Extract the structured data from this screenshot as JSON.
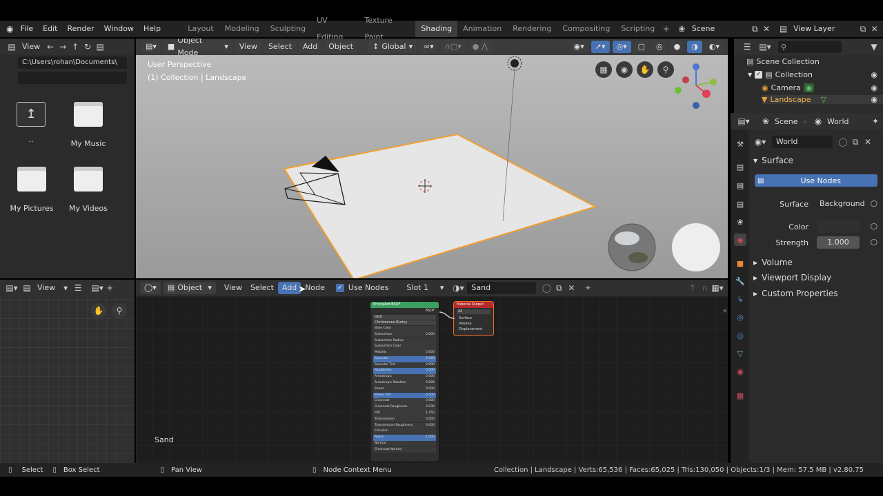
{
  "menu": {
    "file": "File",
    "edit": "Edit",
    "render": "Render",
    "window": "Window",
    "help": "Help"
  },
  "workspaces": [
    {
      "label": "Layout",
      "active": false
    },
    {
      "label": "Modeling",
      "active": false
    },
    {
      "label": "Sculpting",
      "active": false
    },
    {
      "label": "UV Editing",
      "active": false
    },
    {
      "label": "Texture Paint",
      "active": false
    },
    {
      "label": "Shading",
      "active": true
    },
    {
      "label": "Animation",
      "active": false
    },
    {
      "label": "Rendering",
      "active": false
    },
    {
      "label": "Compositing",
      "active": false
    },
    {
      "label": "Scripting",
      "active": false
    }
  ],
  "scene_name": "Scene",
  "view_layer_name": "View Layer",
  "file_browser": {
    "view_label": "View",
    "path": "C:\\Users\\rohan\\Documents\\",
    "parent_label": "..",
    "folders": [
      "My Music",
      "My Pictures",
      "My Videos"
    ]
  },
  "viewport": {
    "mode": "Object Mode",
    "view": "View",
    "select": "Select",
    "add": "Add",
    "object": "Object",
    "orientation": "Global",
    "perspective_label": "User Perspective",
    "collection_label": "(1) Collection | Landscape"
  },
  "outliner": {
    "scene_collection": "Scene Collection",
    "collection": "Collection",
    "camera": "Camera",
    "landscape": "Landscape"
  },
  "properties": {
    "scene_tab": "Scene",
    "world_tab": "World",
    "world_name": "World",
    "surface_panel": "Surface",
    "use_nodes_button": "Use Nodes",
    "surface_label": "Surface",
    "surface_value": "Background",
    "color_label": "Color",
    "strength_label": "Strength",
    "strength_value": "1.000",
    "volume_panel": "Volume",
    "viewport_display_panel": "Viewport Display",
    "custom_properties_panel": "Custom Properties",
    "colors": {
      "use_nodes_bg": "#4772b3",
      "accent": "#e8a040"
    }
  },
  "image_editor": {
    "view": "View"
  },
  "node_editor": {
    "object_label": "Object",
    "view": "View",
    "select": "Select",
    "add": "Add",
    "node": "Node",
    "use_nodes": "Use Nodes",
    "slot": "Slot 1",
    "material": "Sand",
    "material_label": "Sand",
    "principled_title": "Principled BSDF",
    "principled_output": "BSDF",
    "dist": "GGX",
    "subsurface_method": "Christensen-Burley",
    "output_title": "Material Output",
    "output_target": "All",
    "output_sockets": [
      "Surface",
      "Volume",
      "Displacement"
    ],
    "principled_inputs": [
      {
        "label": "Base Color",
        "value": ""
      },
      {
        "label": "Subsurface",
        "value": "0.000"
      },
      {
        "label": "Subsurface Radius",
        "value": ""
      },
      {
        "label": "Subsurface Color",
        "value": ""
      },
      {
        "label": "Metallic",
        "value": "0.000"
      },
      {
        "label": "Specular",
        "value": "0.500"
      },
      {
        "label": "Specular Tint",
        "value": "0.000"
      },
      {
        "label": "Roughness",
        "value": "0.500"
      },
      {
        "label": "Anisotropic",
        "value": "0.000"
      },
      {
        "label": "Anisotropic Rotation",
        "value": "0.000"
      },
      {
        "label": "Sheen",
        "value": "0.000"
      },
      {
        "label": "Sheen Tint",
        "value": "0.500"
      },
      {
        "label": "Clearcoat",
        "value": "0.000"
      },
      {
        "label": "Clearcoat Roughness",
        "value": "0.030"
      },
      {
        "label": "IOR",
        "value": "1.450"
      },
      {
        "label": "Transmission",
        "value": "0.000"
      },
      {
        "label": "Transmission Roughness",
        "value": "0.000"
      },
      {
        "label": "Emission",
        "value": ""
      },
      {
        "label": "Alpha",
        "value": "1.000"
      },
      {
        "label": "Normal",
        "value": ""
      },
      {
        "label": "Clearcoat Normal",
        "value": ""
      }
    ]
  },
  "status": {
    "select": "Select",
    "box_select": "Box Select",
    "pan_view": "Pan View",
    "context_menu": "Node Context Menu",
    "stats": "Collection | Landscape | Verts:65,536 | Faces:65,025 | Tris:130,050 | Objects:1/3 | Mem: 57.5 MB | v2.80.75"
  }
}
